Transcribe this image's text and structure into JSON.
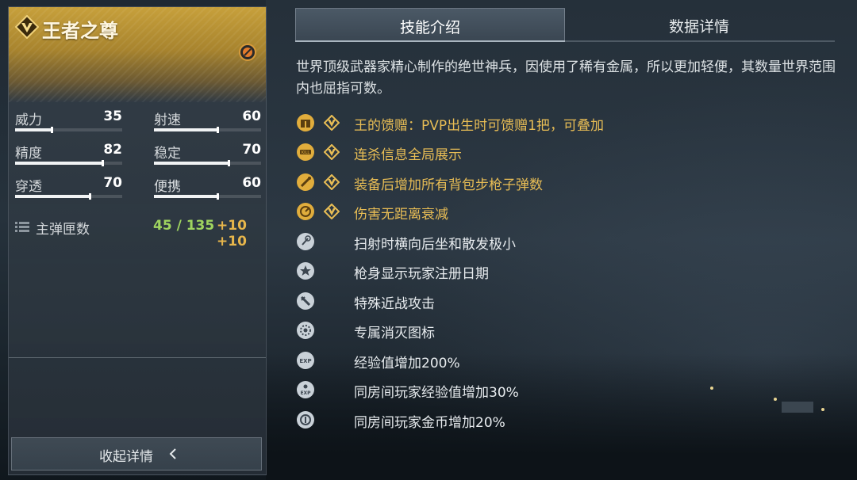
{
  "weapon": {
    "name": "王者之尊",
    "stats": [
      {
        "label": "威力",
        "value": "35",
        "level": 0.35
      },
      {
        "label": "射速",
        "value": "60",
        "level": 0.6
      },
      {
        "label": "精度",
        "value": "82",
        "level": 0.82
      },
      {
        "label": "稳定",
        "value": "70",
        "level": 0.7
      },
      {
        "label": "穿透",
        "value": "70",
        "level": 0.7
      },
      {
        "label": "便携",
        "value": "60",
        "level": 0.6
      }
    ],
    "ammo": {
      "label": "主弹匣数",
      "value": "45 / 135",
      "bonus": "+10 +10"
    },
    "collapse_label": "收起详情"
  },
  "tabs": [
    {
      "label": "技能介绍",
      "active": true
    },
    {
      "label": "数据详情",
      "active": false
    }
  ],
  "description": "世界顶级武器家精心制作的绝世神兵，因使用了稀有金属，所以更加轻便，其数量世界范围内也屈指可数。",
  "skills": [
    {
      "icon": "gift-icon",
      "vip": true,
      "text": "王的馈赠：PVP出生时可馈赠1把，可叠加"
    },
    {
      "icon": "killfeed-icon",
      "vip": true,
      "text": "连杀信息全局展示"
    },
    {
      "icon": "bullet-icon",
      "vip": true,
      "text": "装备后增加所有背包步枪子弹数"
    },
    {
      "icon": "target-icon",
      "vip": true,
      "text": "伤害无距离衰减"
    },
    {
      "icon": "recoil-icon",
      "vip": false,
      "text": "扫射时横向后坐和散发极小"
    },
    {
      "icon": "star-icon",
      "vip": false,
      "text": "枪身显示玩家注册日期"
    },
    {
      "icon": "melee-icon",
      "vip": false,
      "text": "特殊近战攻击"
    },
    {
      "icon": "kill-mark-icon",
      "vip": false,
      "text": "专属消灭图标"
    },
    {
      "icon": "exp-icon",
      "vip": false,
      "text": "经验值增加200%"
    },
    {
      "icon": "room-exp-icon",
      "vip": false,
      "text": "同房间玩家经验值增加30%"
    },
    {
      "icon": "coin-icon",
      "vip": false,
      "text": "同房间玩家金币增加20%"
    }
  ],
  "colors": {
    "gold": "#e8bd55",
    "ammo_green": "#9fd45f",
    "bonus_orange": "#e7b64b"
  }
}
